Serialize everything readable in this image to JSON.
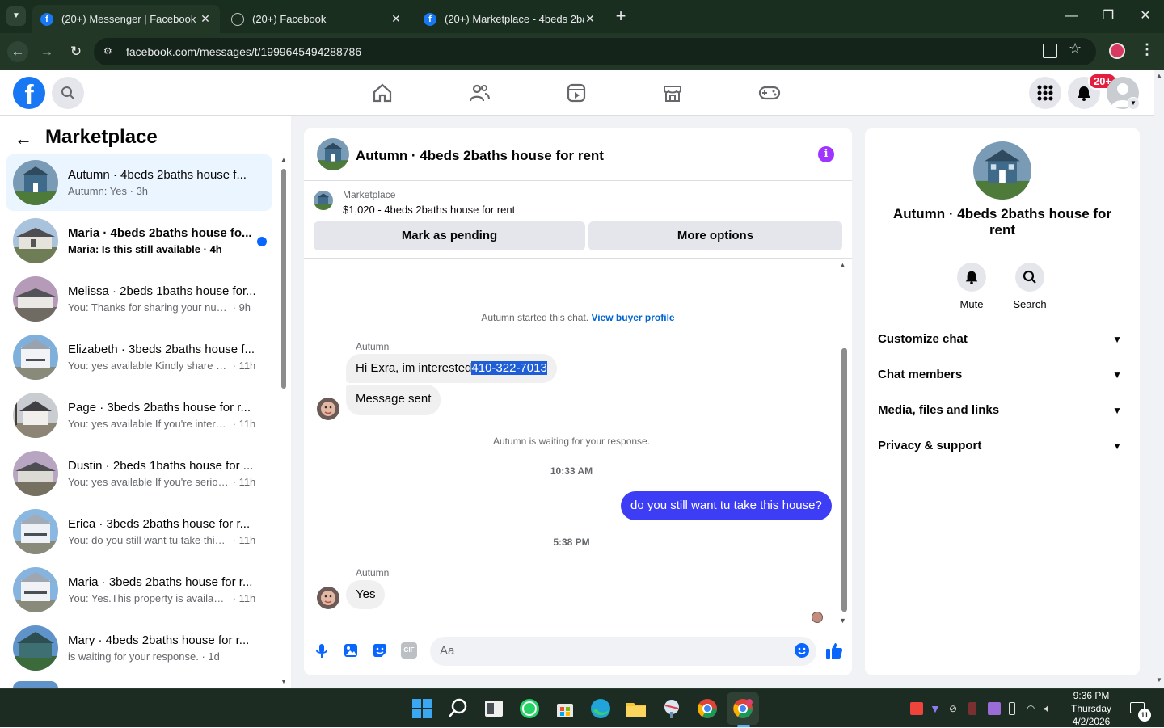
{
  "browser": {
    "tabs": [
      {
        "label": "(20+) Messenger | Facebook",
        "favicon": "facebook-icon",
        "active": true
      },
      {
        "label": "(20+) Facebook",
        "favicon": "loading-icon",
        "active": false
      },
      {
        "label": "(20+) Marketplace - 4beds 2bat",
        "favicon": "facebook-icon",
        "active": false
      }
    ],
    "url": "facebook.com/messages/t/1999645494288786"
  },
  "fb_nav": {
    "notification_badge": "20+"
  },
  "sidebar": {
    "title": "Marketplace",
    "conversations": [
      {
        "title": "Autumn · 4beds 2baths house f...",
        "preview": "Autumn: Yes",
        "time": "3h",
        "selected": true,
        "unread": false
      },
      {
        "title": "Maria · 4beds 2baths house fo...",
        "preview": "Maria: Is this still available",
        "time": "4h",
        "selected": false,
        "unread": true
      },
      {
        "title": "Melissa · 2beds 1baths house for...",
        "preview": "You: Thanks for sharing your numb...",
        "time": "9h",
        "selected": false,
        "unread": false
      },
      {
        "title": "Elizabeth · 3beds 2baths house f...",
        "preview": "You: yes available Kindly share yo...",
        "time": "11h",
        "selected": false,
        "unread": false
      },
      {
        "title": "Page · 3beds 2baths house for r...",
        "preview": "You: yes available If you're interest...",
        "time": "11h",
        "selected": false,
        "unread": false
      },
      {
        "title": "Dustin · 2beds 1baths house for ...",
        "preview": "You: yes available If you're seriousl...",
        "time": "11h",
        "selected": false,
        "unread": false
      },
      {
        "title": "Erica · 3beds 2baths house for r...",
        "preview": "You: do you still want tu take this ...",
        "time": "11h",
        "selected": false,
        "unread": false
      },
      {
        "title": "Maria · 3beds 2baths house for r...",
        "preview": "You: Yes.This property is available ...",
        "time": "11h",
        "selected": false,
        "unread": false
      },
      {
        "title": "Mary · 4beds 2baths house for r...",
        "preview": "is waiting for your response.",
        "time": "1d",
        "selected": false,
        "unread": false
      }
    ]
  },
  "chat": {
    "title": "Autumn · 4beds 2baths house for rent",
    "listing_source": "Marketplace",
    "listing_text": "$1,020 - 4beds 2baths house for rent",
    "mark_pending_label": "Mark as pending",
    "more_options_label": "More options",
    "started_text": "Autumn started this chat.",
    "view_profile_link": "View buyer profile",
    "messages": {
      "sender_1": "Autumn",
      "msg_1_text": "Hi Exra, im interested",
      "msg_1_phone": "410-322-7013",
      "msg_2": "Message sent",
      "waiting": "Autumn is waiting for your response.",
      "time_1": "10:33 AM",
      "msg_out": "do you still want tu take this house?",
      "time_2": "5:38 PM",
      "sender_2": "Autumn",
      "msg_3": "Yes"
    },
    "input_placeholder": "Aa"
  },
  "right_panel": {
    "name": "Autumn · 4beds 2baths house for rent",
    "mute_label": "Mute",
    "search_label": "Search",
    "sections": [
      "Customize chat",
      "Chat members",
      "Media, files and links",
      "Privacy & support"
    ]
  },
  "taskbar": {
    "time": "9:36 PM",
    "day": "Thursday",
    "date": "4/2/2026",
    "notif_count": "11"
  },
  "colors": {
    "brand": "#1877f2",
    "outgoing_bubble": "#3c3df5",
    "chrome_dark": "#1a2e1f"
  }
}
